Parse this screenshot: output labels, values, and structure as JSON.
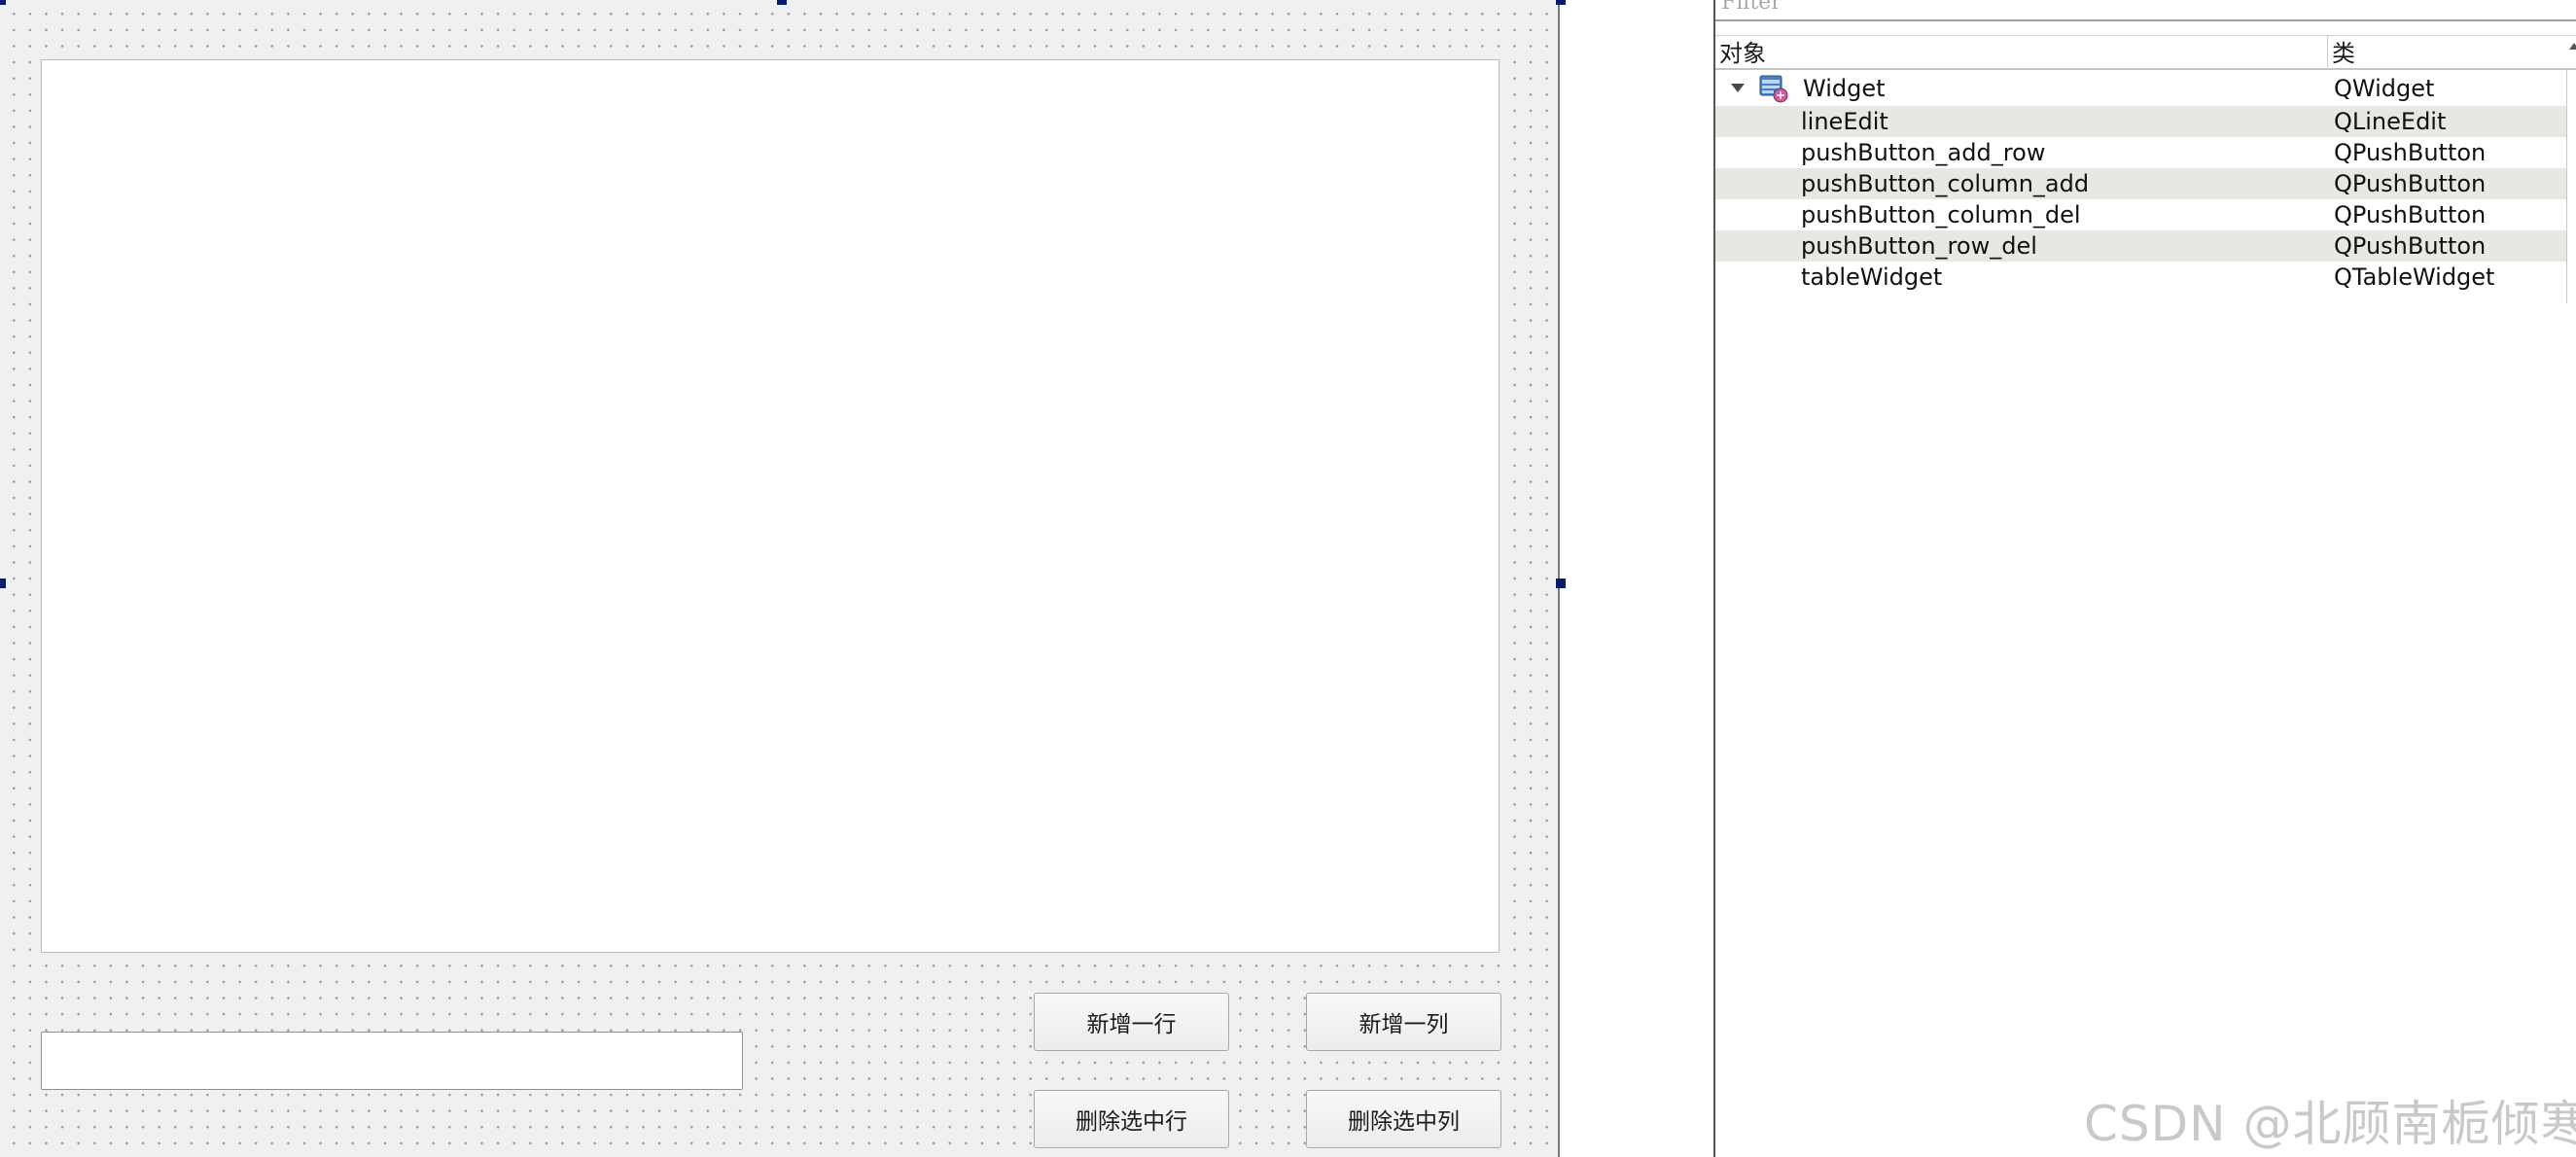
{
  "designer": {
    "buttons": {
      "add_row": "新增一行",
      "add_column": "新增一列",
      "delete_row": "删除选中行",
      "delete_column": "删除选中列"
    },
    "line_edit": {
      "value": ""
    }
  },
  "inspector": {
    "filter_placeholder": "Filter",
    "columns": {
      "object": "对象",
      "class": "类"
    },
    "root": {
      "name": "Widget",
      "class": "QWidget",
      "icon": "widget-icon",
      "expanded": true
    },
    "children": [
      {
        "name": "lineEdit",
        "class": "QLineEdit"
      },
      {
        "name": "pushButton_add_row",
        "class": "QPushButton"
      },
      {
        "name": "pushButton_column_add",
        "class": "QPushButton"
      },
      {
        "name": "pushButton_column_del",
        "class": "QPushButton"
      },
      {
        "name": "pushButton_row_del",
        "class": "QPushButton"
      },
      {
        "name": "tableWidget",
        "class": "QTableWidget"
      }
    ]
  },
  "watermark": "CSDN @北顾南栀倾寒",
  "colors": {
    "selection_handle": "#0a1a6e",
    "alt_row": "#e8e7e3",
    "canvas": "#f0f0f0"
  }
}
